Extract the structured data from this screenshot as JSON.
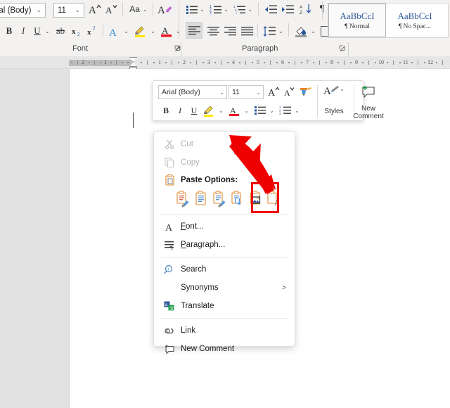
{
  "app": "Microsoft Word",
  "ribbon": {
    "font_group": {
      "label": "Font",
      "font_name": "rial (Body)",
      "font_size": "11",
      "grow_font": "A",
      "shrink_font": "A",
      "change_case": "Aa",
      "clear_formatting": "A",
      "bold": "B",
      "italic": "I",
      "underline": "U",
      "strikethrough": "ab",
      "subscript": "x",
      "superscript": "x",
      "text_effects": "A",
      "highlight": "A",
      "font_color": "A",
      "dialog_launcher": "⌐"
    },
    "paragraph_group": {
      "label": "Paragraph",
      "bullets": "bullets-icon",
      "numbering": "numbering-icon",
      "multilevel": "multilevel-list-icon",
      "decrease_indent": "decrease-indent-icon",
      "increase_indent": "increase-indent-icon",
      "sort": "sort-icon",
      "show_marks": "¶",
      "align_left": "align-left-icon",
      "align_center": "align-center-icon",
      "align_right": "align-right-icon",
      "justify": "justify-icon",
      "line_spacing": "line-spacing-icon",
      "shading": "shading-icon",
      "borders": "borders-icon",
      "dialog_launcher": "⌐"
    },
    "styles": [
      {
        "preview": "AaBbCcI",
        "name": "¶ Normal",
        "selected": true
      },
      {
        "preview": "AaBbCcI",
        "name": "¶ No Spac...",
        "selected": false
      }
    ]
  },
  "ruler": {
    "left_ticks": [
      "2",
      "1"
    ],
    "right_ticks": [
      "1",
      "2",
      "3",
      "4",
      "5",
      "6",
      "7",
      "8",
      "9",
      "10",
      "11",
      "12"
    ]
  },
  "mini_toolbar": {
    "font_name": "Arial (Body)",
    "font_size": "11",
    "grow_font": "A",
    "shrink_font": "A",
    "format_painter": "format-painter-icon",
    "styles_label": "Styles",
    "new_comment_label": "New\nComment",
    "new_comment_line1": "New",
    "new_comment_line2": "Comment",
    "bold": "B",
    "italic": "I",
    "underline": "U",
    "highlight": "highlight-icon",
    "font_color": "A",
    "bullets": "bullets-icon",
    "numbering": "numbering-icon"
  },
  "context_menu": {
    "items": [
      {
        "name": "cut",
        "label": "Cut",
        "icon": "scissors-icon",
        "disabled": true,
        "underline_index": 2
      },
      {
        "name": "copy",
        "label": "Copy",
        "icon": "copy-icon",
        "disabled": true,
        "underline_index": 0
      },
      {
        "name": "paste-options",
        "label": "Paste Options:",
        "icon": "clipboard-icon",
        "header": true
      }
    ],
    "paste_options": [
      {
        "name": "keep-source-formatting",
        "icon": "paste-keep-source-icon",
        "highlighted": false
      },
      {
        "name": "merge-formatting",
        "icon": "paste-merge-icon",
        "highlighted": false
      },
      {
        "name": "keep-text-only-brush",
        "icon": "paste-format-brush-icon",
        "highlighted": false
      },
      {
        "name": "paste-link",
        "icon": "paste-link-icon",
        "highlighted": false
      },
      {
        "name": "paste-picture",
        "icon": "paste-picture-icon",
        "highlighted": true
      },
      {
        "name": "keep-text-only",
        "icon": "paste-text-only-icon",
        "highlighted": false
      }
    ],
    "lower_items": [
      {
        "name": "font",
        "label": "Font...",
        "icon": "font-A-icon",
        "arrow": false
      },
      {
        "name": "paragraph",
        "label": "Paragraph...",
        "icon": "paragraph-icon",
        "arrow": false
      },
      {
        "name": "search",
        "label": "Search",
        "icon": "search-icon",
        "arrow": false
      },
      {
        "name": "synonyms",
        "label": "Synonyms",
        "icon": "",
        "arrow": true
      },
      {
        "name": "translate",
        "label": "Translate",
        "icon": "translate-icon",
        "arrow": false
      },
      {
        "name": "link",
        "label": "Link",
        "icon": "link-icon",
        "arrow": false
      },
      {
        "name": "new-comment",
        "label": "New Comment",
        "icon": "new-comment-icon",
        "arrow": false
      }
    ]
  },
  "annotation": {
    "arrow": "red-arrow-pointer",
    "highlight_color": "#ef0000",
    "target": "paste-picture"
  },
  "colors": {
    "ribbon_bg": "#f3f2f1",
    "page_bg": "#ffffff",
    "doc_bg": "#e2e2e2",
    "accent_blue": "#2b579a",
    "annotation_red": "#ef0000"
  }
}
